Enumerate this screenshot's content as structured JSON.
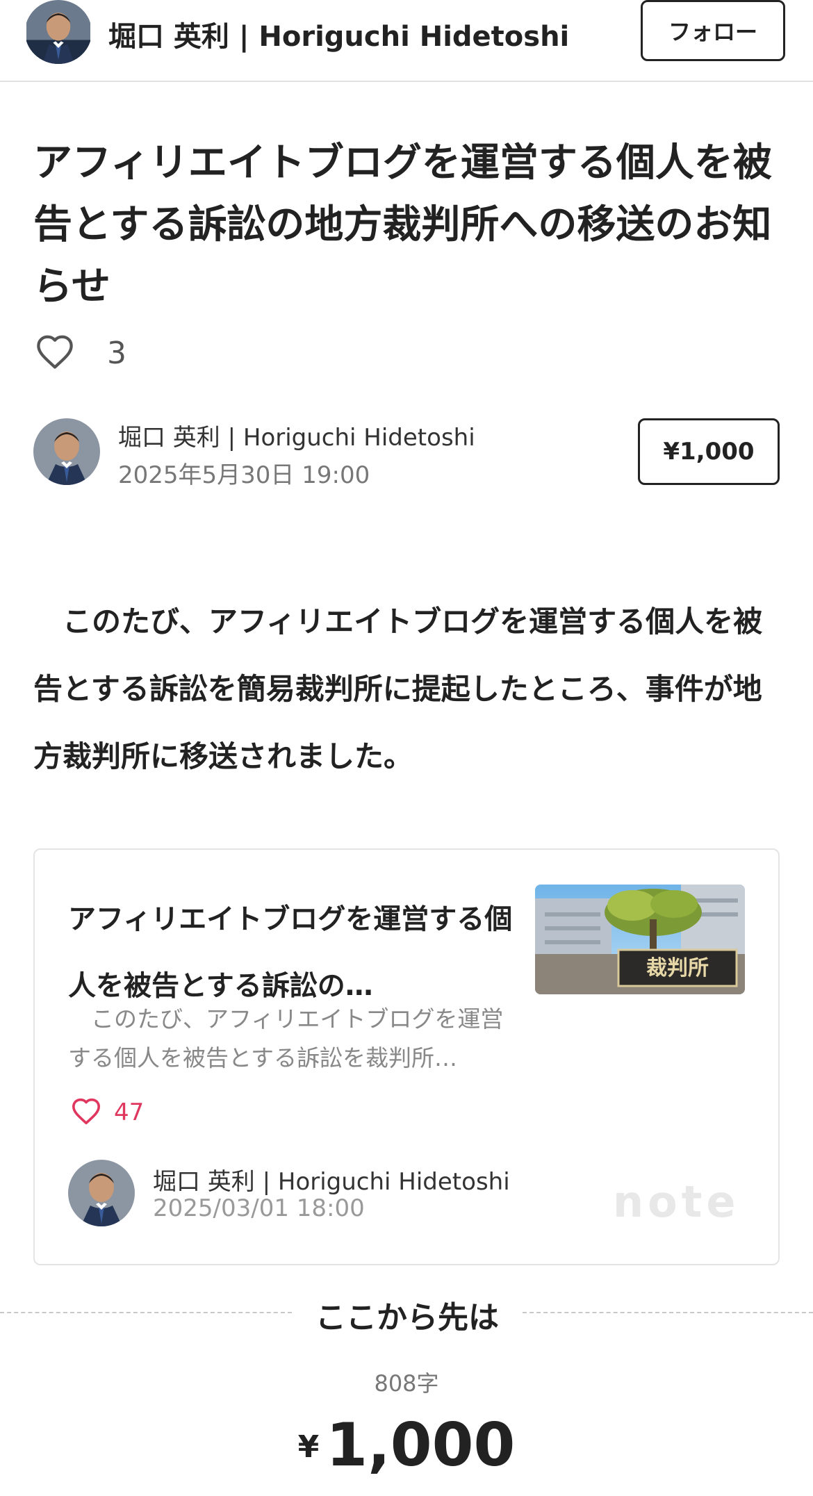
{
  "header": {
    "name": "堀口 英利 | Horiguchi Hidetoshi",
    "follow_label": "フォロー"
  },
  "article": {
    "title": "アフィリエイトブログを運営する個人を被告とする訴訟の地方裁判所への移送のお知らせ",
    "like_count": "3",
    "author_name": "堀口 英利 | Horiguchi Hidetoshi",
    "date": "2025年5月30日 19:00",
    "price_label": "¥1,000",
    "body": "　このたび、アフィリエイトブログを運営する個人を被告とする訴訟を簡易裁判所に提起したところ、事件が地方裁判所に移送されました。"
  },
  "embed_card": {
    "title": "アフィリエイトブログを運営する個人を被告とする訴訟の…",
    "excerpt": "　このたび、アフィリエイトブログを運営する個人を被告とする訴訟を裁判所…",
    "like_count": "47",
    "author_name": "堀口 英利 | Horiguchi Hidetoshi",
    "date": "2025/03/01 18:00",
    "brand": "note",
    "thumbnail_plaque_text": "裁判所"
  },
  "paywall": {
    "divider_label": "ここから先は",
    "char_count": "808字",
    "currency": "¥",
    "amount": "1,000"
  },
  "colors": {
    "like_accent": "#e0375f",
    "border": "#e4e4e4"
  },
  "icons": {
    "like": "heart-outline-icon",
    "card_like": "heart-outline-icon"
  }
}
